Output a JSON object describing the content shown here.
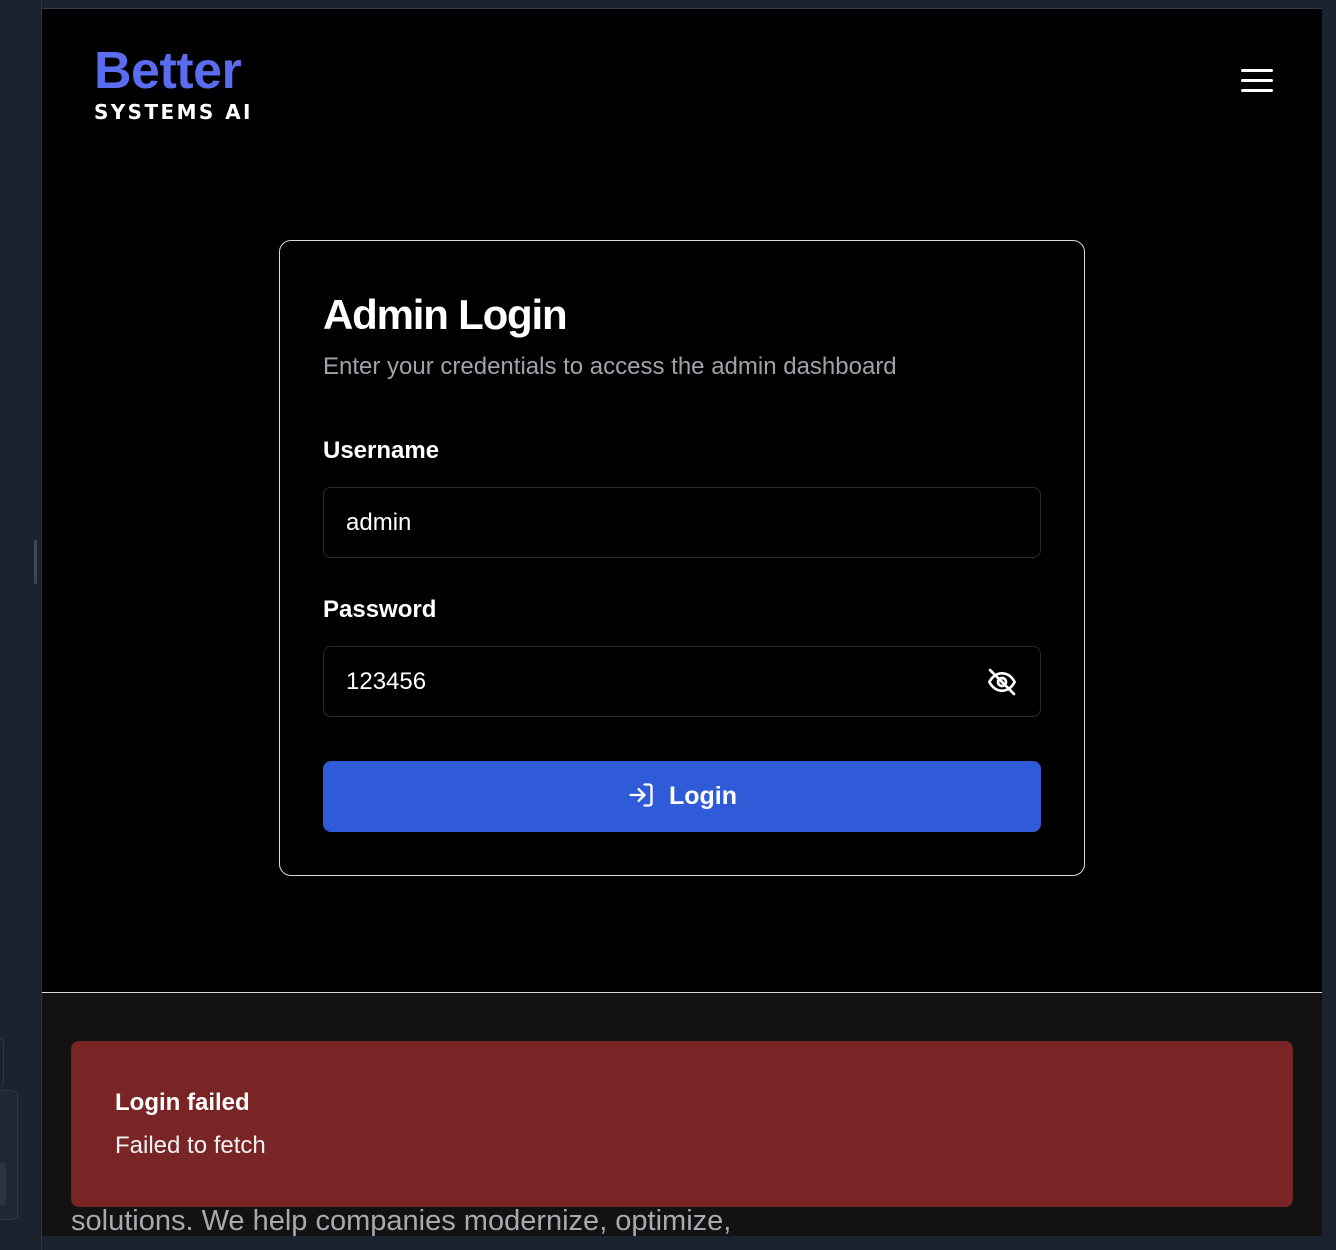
{
  "header": {
    "logo_primary": "Better",
    "logo_secondary": "SYSTEMS AI",
    "menu_icon": "hamburger-menu-icon"
  },
  "login": {
    "title": "Admin Login",
    "subtitle": "Enter your credentials to access the admin dashboard",
    "username_label": "Username",
    "username_value": "admin",
    "password_label": "Password",
    "password_value": "123456",
    "password_toggle_icon": "eye-off-icon",
    "submit_label": "Login",
    "submit_icon": "log-in-icon"
  },
  "toast": {
    "title": "Login failed",
    "message": "Failed to fetch"
  },
  "footer": {
    "partial_text": "solutions. We help companies modernize, optimize,"
  },
  "colors": {
    "brand": "#5a6cf0",
    "primary_button": "#2f5bd8",
    "error_toast": "#7a2525",
    "background": "#000000"
  }
}
